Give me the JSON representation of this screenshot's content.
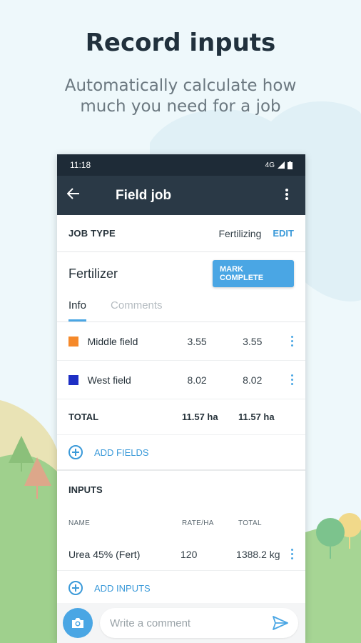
{
  "promo": {
    "headline": "Record inputs",
    "subline": "Automatically calculate how much you need for a job"
  },
  "status_bar": {
    "time": "11:18",
    "network": "4G"
  },
  "toolbar": {
    "title": "Field job"
  },
  "job_type": {
    "label": "JOB TYPE",
    "value": "Fertilizing",
    "edit_label": "EDIT"
  },
  "job": {
    "name": "Fertilizer",
    "complete_label": "MARK COMPLETE",
    "tabs": [
      {
        "label": "Info",
        "active": true
      },
      {
        "label": "Comments",
        "active": false
      }
    ]
  },
  "fields": [
    {
      "name": "Middle field",
      "rate": "3.55",
      "total": "3.55",
      "color": "#f5892a"
    },
    {
      "name": "West field",
      "rate": "8.02",
      "total": "8.02",
      "color": "#1e2fc4"
    }
  ],
  "totals": {
    "label": "TOTAL",
    "rate": "11.57 ha",
    "total": "11.57 ha"
  },
  "add_fields_label": "ADD FIELDS",
  "inputs": {
    "heading": "INPUTS",
    "columns": {
      "name": "NAME",
      "rate": "RATE/HA",
      "total": "TOTAL"
    },
    "rows": [
      {
        "name": "Urea 45%  (Fert)",
        "rate": "120",
        "total": "1388.2 kg"
      }
    ],
    "add_label": "ADD INPUTS"
  },
  "comment": {
    "placeholder": "Write a comment"
  },
  "colors": {
    "accent": "#4aa6e4",
    "toolbar": "#2a3946",
    "status_bar": "#1e2b37"
  }
}
